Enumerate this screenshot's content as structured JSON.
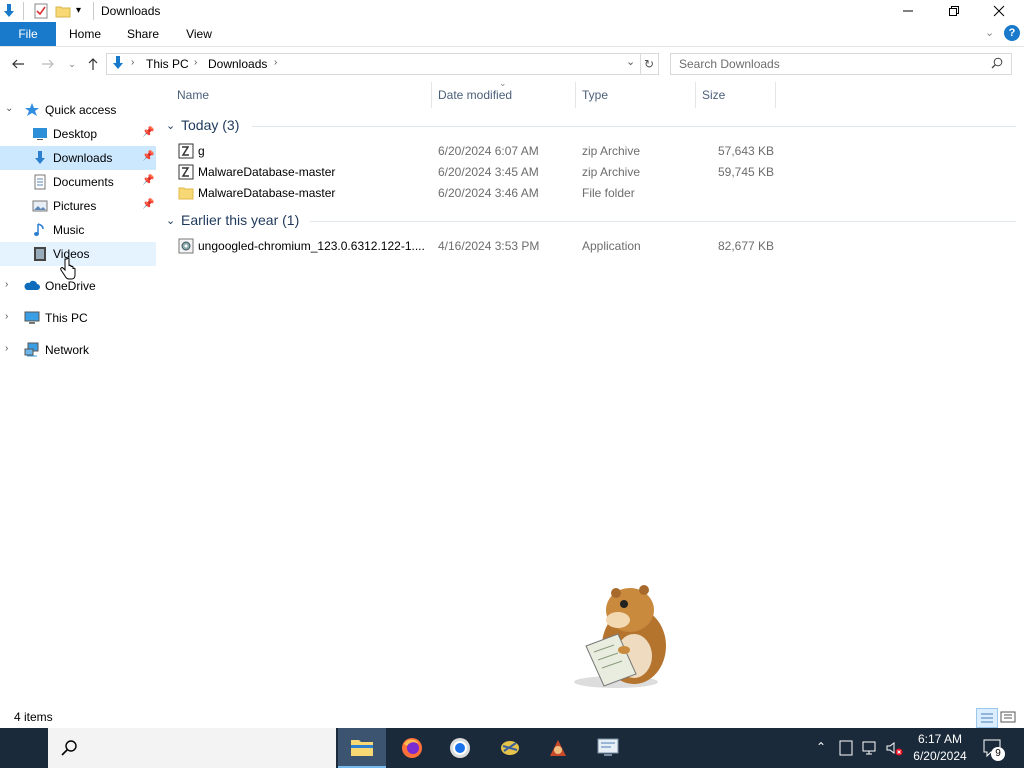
{
  "window": {
    "title": "Downloads"
  },
  "ribbon": {
    "tabs": [
      "File",
      "Home",
      "Share",
      "View"
    ]
  },
  "address": {
    "crumbs": [
      "This PC",
      "Downloads"
    ]
  },
  "search": {
    "placeholder": "Search Downloads"
  },
  "nav": {
    "quick_access": "Quick access",
    "items": [
      {
        "label": "Desktop",
        "icon": "desktop-icon",
        "pinned": true
      },
      {
        "label": "Downloads",
        "icon": "download-icon",
        "pinned": true
      },
      {
        "label": "Documents",
        "icon": "documents-icon",
        "pinned": true
      },
      {
        "label": "Pictures",
        "icon": "pictures-icon",
        "pinned": true
      },
      {
        "label": "Music",
        "icon": "music-icon",
        "pinned": false
      },
      {
        "label": "Videos",
        "icon": "videos-icon",
        "pinned": false
      }
    ],
    "roots": [
      {
        "label": "OneDrive",
        "icon": "onedrive-icon"
      },
      {
        "label": "This PC",
        "icon": "this-pc-icon"
      },
      {
        "label": "Network",
        "icon": "network-icon"
      }
    ]
  },
  "columns": [
    "Name",
    "Date modified",
    "Type",
    "Size"
  ],
  "groups": [
    {
      "title": "Today (3)",
      "rows": [
        {
          "name": "g",
          "date": "6/20/2024 6:07 AM",
          "type": "zip Archive",
          "size": "57,643 KB",
          "icon": "zip-icon"
        },
        {
          "name": "MalwareDatabase-master",
          "date": "6/20/2024 3:45 AM",
          "type": "zip Archive",
          "size": "59,745 KB",
          "icon": "zip-icon"
        },
        {
          "name": "MalwareDatabase-master",
          "date": "6/20/2024 3:46 AM",
          "type": "File folder",
          "size": "",
          "icon": "folder-icon"
        }
      ]
    },
    {
      "title": "Earlier this year (1)",
      "rows": [
        {
          "name": "ungoogled-chromium_123.0.6312.122-1....",
          "date": "4/16/2024 3:53 PM",
          "type": "Application",
          "size": "82,677 KB",
          "icon": "application-icon"
        }
      ]
    }
  ],
  "status": {
    "count": "4 items"
  },
  "taskbar": {
    "time": "6:17 AM",
    "date": "6/20/2024",
    "notification_count": "9"
  },
  "colors": {
    "accent": "#1979ca",
    "selected": "#cce8ff",
    "taskbar": "#1b2a3a"
  }
}
